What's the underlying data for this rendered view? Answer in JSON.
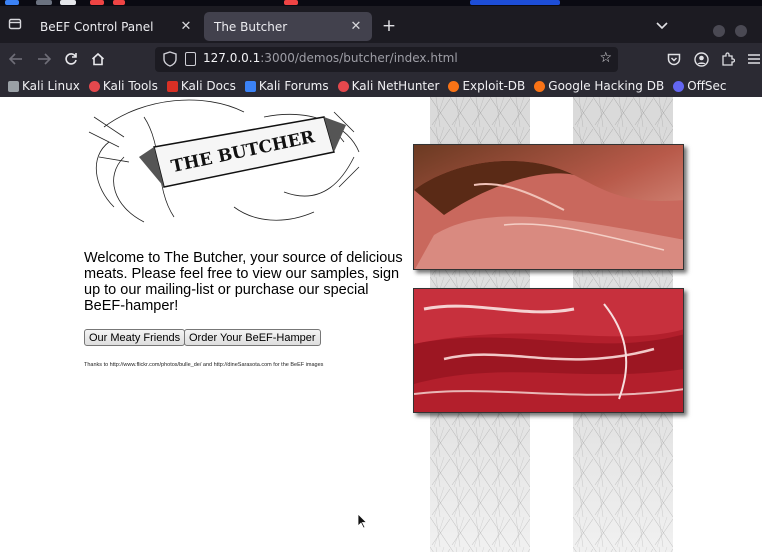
{
  "tabs": [
    {
      "label": "BeEF Control Panel",
      "active": false
    },
    {
      "label": "The Butcher",
      "active": true
    }
  ],
  "address_bar": {
    "url_host": "127.0.0.1",
    "url_rest": ":3000/demos/butcher/index.html"
  },
  "bookmarks": [
    {
      "label": "Kali Linux",
      "color": "#9aa0a6"
    },
    {
      "label": "Kali Tools",
      "color": "#e5484d"
    },
    {
      "label": "Kali Docs",
      "color": "#d93025"
    },
    {
      "label": "Kali Forums",
      "color": "#3b82f6"
    },
    {
      "label": "Kali NetHunter",
      "color": "#e5484d"
    },
    {
      "label": "Exploit-DB",
      "color": "#f97316"
    },
    {
      "label": "Google Hacking DB",
      "color": "#f97316"
    },
    {
      "label": "OffSec",
      "color": "#6366f1"
    }
  ],
  "page": {
    "logo_text": "THE BUTCHER",
    "intro": "Welcome to The Butcher, your source of delicious meats. Please feel free to view our samples, sign up to our mailing-list or purchase our special BeEF-hamper!",
    "buttons": {
      "friends": "Our Meaty Friends",
      "hamper": "Order Your BeEF-Hamper"
    },
    "credits": "Thanks to http://www.flickr.com/photos/bulle_de/ and http://dineSarasota.com for the BeEF images"
  },
  "colors": {
    "tabbar_bg": "#1c1b22",
    "toolbar_bg": "#2b2a33",
    "active_tab_bg": "#42414d"
  }
}
